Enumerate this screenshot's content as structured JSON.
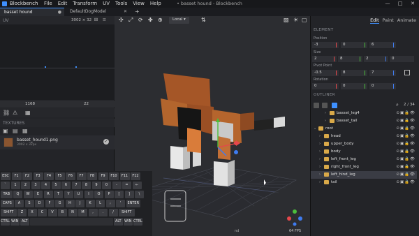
{
  "titlebar": {
    "app_name": "Blockbench",
    "menu": [
      "File",
      "Edit",
      "Transform",
      "UV",
      "Tools",
      "View",
      "Help"
    ],
    "window_title": "• basset hound - Blockbench",
    "minimize": "—",
    "maximize": "□",
    "close": "✕"
  },
  "tabs": [
    {
      "label": "basset hound",
      "close": "●"
    },
    {
      "label": "DefaultDogModel",
      "close": "✕"
    }
  ],
  "new_tab": "+",
  "uv": {
    "title": "UV",
    "size": "3002 × 32",
    "value_1": "1168",
    "value_2": "22"
  },
  "textures": {
    "title": "TEXTURES",
    "name": "basset_hound1.png",
    "size": "3002 x 32px"
  },
  "viewport": {
    "transform_space": "Local",
    "fps": "64 FPS",
    "status": "nd"
  },
  "right_tabs": [
    "Edit",
    "Paint",
    "Animate"
  ],
  "element": {
    "title": "ELEMENT",
    "position_label": "Position",
    "position": [
      "-3",
      "0",
      "6"
    ],
    "size_label": "Size",
    "size": [
      "2",
      "8",
      "2"
    ],
    "size_extra": "0",
    "pivot_label": "Pivot Point",
    "pivot": [
      "-0.5",
      "8",
      "7"
    ],
    "rotation_label": "Rotation",
    "rotation": [
      "0",
      "0",
      "0"
    ]
  },
  "outliner": {
    "title": "OUTLINER",
    "count": "2 / 34",
    "rows": [
      {
        "label": "basset_leg4",
        "indent": 2,
        "type": "group"
      },
      {
        "label": "basset_tail",
        "indent": 2,
        "type": "group"
      },
      {
        "label": "root",
        "indent": 0,
        "type": "group",
        "open": true
      },
      {
        "label": "head",
        "indent": 1,
        "type": "group"
      },
      {
        "label": "upper_body",
        "indent": 1,
        "type": "group"
      },
      {
        "label": "body",
        "indent": 1,
        "type": "group"
      },
      {
        "label": "left_front_leg",
        "indent": 1,
        "type": "group"
      },
      {
        "label": "right_front_leg",
        "indent": 1,
        "type": "group"
      },
      {
        "label": "left_hind_leg",
        "indent": 1,
        "type": "group",
        "selected": true
      },
      {
        "label": "tail",
        "indent": 1,
        "type": "group"
      }
    ]
  },
  "keyboard": {
    "rows": [
      [
        "ESC",
        "F1",
        "F2",
        "F3",
        "F4",
        "F5",
        "F6",
        "F7",
        "F8",
        "F9",
        "F10",
        "F11",
        "F12"
      ],
      [
        "`",
        "1",
        "2",
        "3",
        "4",
        "5",
        "6",
        "7",
        "8",
        "9",
        "0",
        "-",
        "=",
        "←"
      ],
      [
        "TAB",
        "Q",
        "W",
        "E",
        "R",
        "T",
        "Y",
        "U",
        "I",
        "O",
        "P",
        "[",
        "]",
        "\\"
      ],
      [
        "CAPS",
        "A",
        "S",
        "D",
        "F",
        "G",
        "H",
        "J",
        "K",
        "L",
        ";",
        "'",
        "ENTER"
      ],
      [
        "SHIFT",
        "Z",
        "X",
        "C",
        "V",
        "B",
        "N",
        "M",
        ",",
        ".",
        "/",
        "SHIFT"
      ],
      [
        "CTRL",
        "WIN",
        "ALT",
        "",
        "ALT",
        "WIN",
        "CTRL"
      ]
    ]
  },
  "colors": {
    "accent": "#3e90ff",
    "x_axis": "#e5474b",
    "y_axis": "#4cbe3c",
    "z_axis": "#3f7cf0",
    "folder": "#d9a949"
  }
}
